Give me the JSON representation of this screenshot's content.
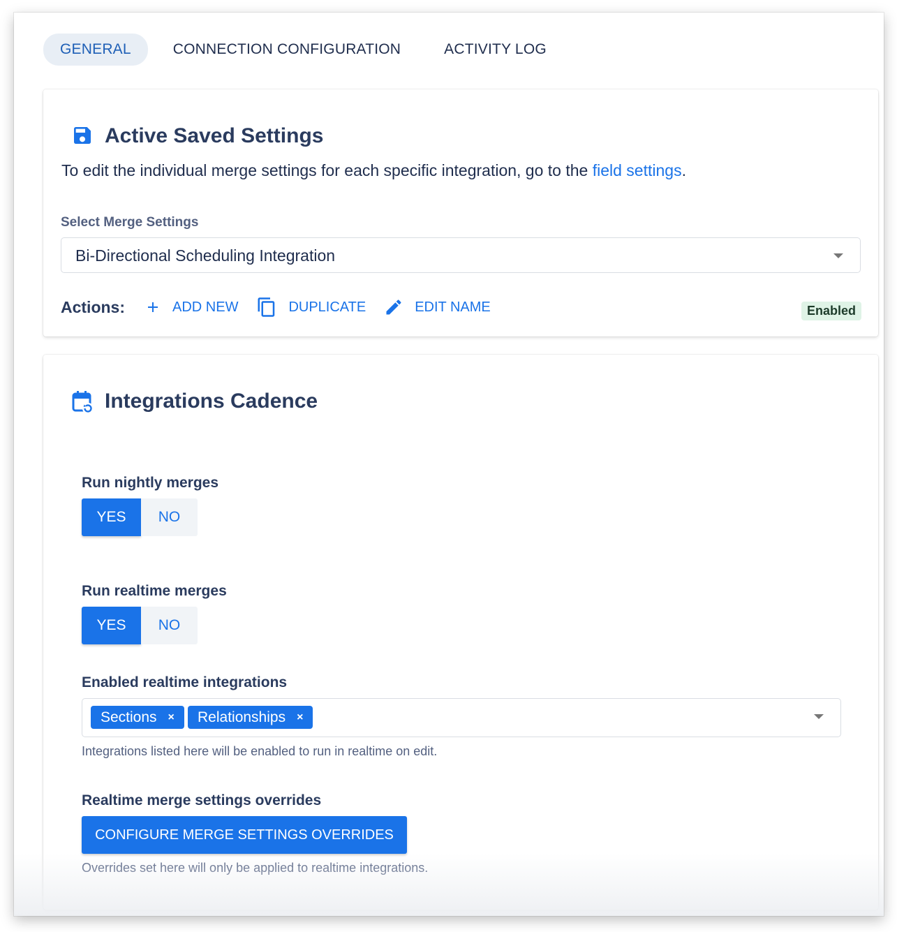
{
  "tabs": [
    {
      "label": "GENERAL",
      "active": true
    },
    {
      "label": "CONNECTION CONFIGURATION",
      "active": false
    },
    {
      "label": "ACTIVITY LOG",
      "active": false
    }
  ],
  "saved_settings": {
    "icon": "save-icon",
    "title": "Active Saved Settings",
    "description_prefix": "To edit the individual merge settings for each specific integration, go to the ",
    "description_link": "field settings",
    "description_suffix": ".",
    "select_label": "Select Merge Settings",
    "select_value": "Bi-Directional Scheduling Integration",
    "actions_label": "Actions:",
    "actions": [
      {
        "icon": "plus-icon",
        "label": "ADD NEW"
      },
      {
        "icon": "copy-icon",
        "label": "DUPLICATE"
      },
      {
        "icon": "pencil-icon",
        "label": "EDIT NAME"
      }
    ],
    "status_badge": "Enabled"
  },
  "cadence": {
    "icon": "calendar-refresh-icon",
    "title": "Integrations Cadence",
    "nightly": {
      "label": "Run nightly merges",
      "yes": "YES",
      "no": "NO",
      "selected": "YES"
    },
    "realtime": {
      "label": "Run realtime merges",
      "yes": "YES",
      "no": "NO",
      "selected": "YES"
    },
    "enabled_integrations": {
      "label": "Enabled realtime integrations",
      "chips": [
        "Sections",
        "Relationships"
      ],
      "chip_remove": "×",
      "help": "Integrations listed here will be enabled to run in realtime on edit."
    },
    "overrides": {
      "label": "Realtime merge settings overrides",
      "button": "CONFIGURE MERGE SETTINGS OVERRIDES",
      "help": "Overrides set here will only be applied to realtime integrations."
    }
  },
  "colors": {
    "accent": "#1a73e8",
    "heading": "#2a3b5e",
    "badge_bg": "#dff3e6"
  }
}
